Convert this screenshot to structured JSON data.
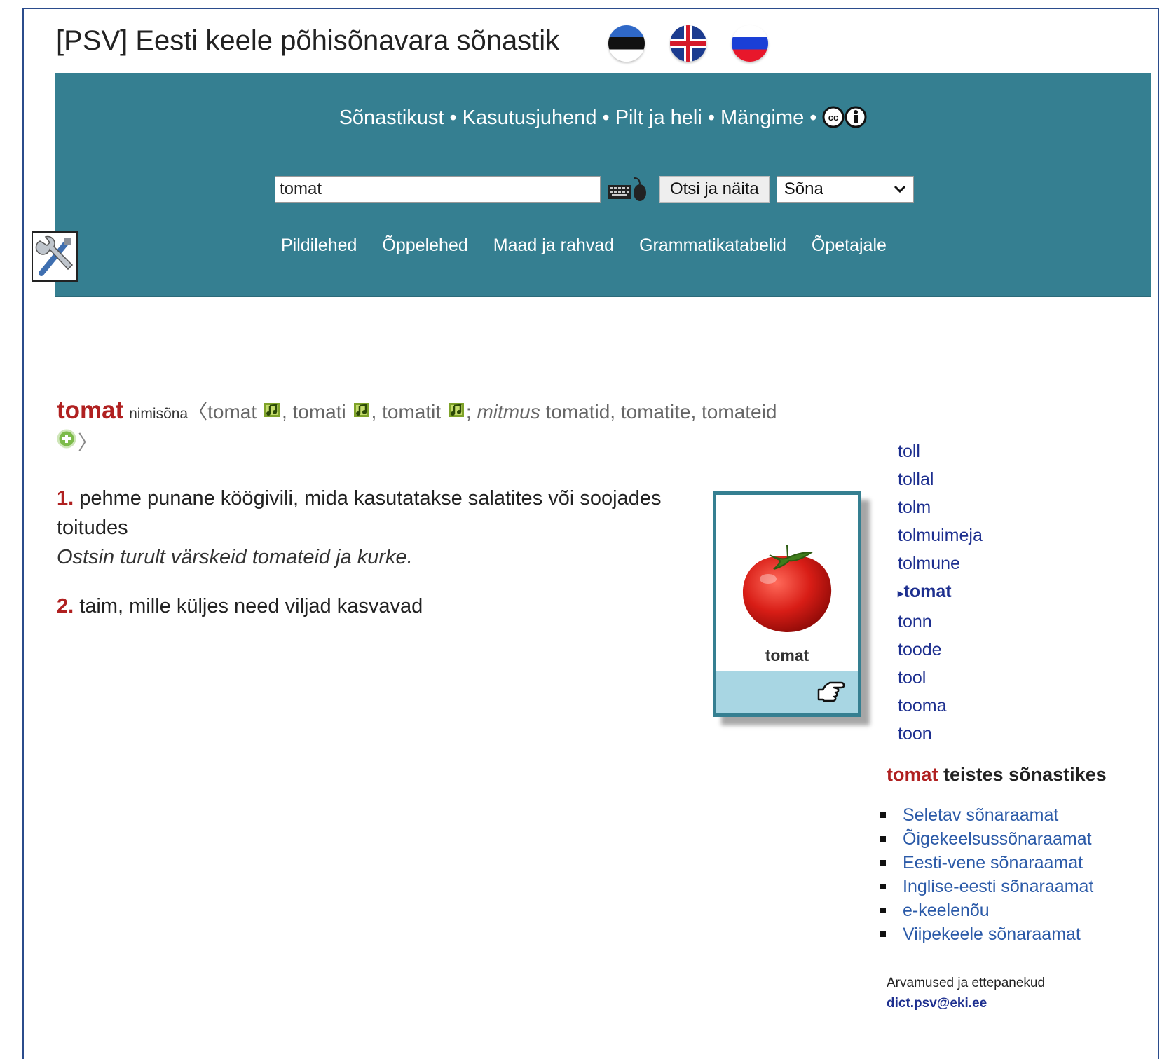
{
  "header": {
    "title": "[PSV] Eesti keele põhisõnavara sõnastik",
    "flags": [
      "ee-flag-icon",
      "gb-flag-icon",
      "ru-flag-icon"
    ]
  },
  "nav": {
    "links": [
      "Sõnastikust",
      "Kasutusjuhend",
      "Pilt ja heli",
      "Mängime"
    ],
    "separator": "•"
  },
  "search": {
    "value": "tomat",
    "button_label": "Otsi ja näita",
    "select_value": "Sõna"
  },
  "subnav": [
    "Pildilehed",
    "Õppelehed",
    "Maad ja rahvad",
    "Grammatikatabelid",
    "Õpetajale"
  ],
  "entry": {
    "headword": "tomat",
    "pos": "nimisõna",
    "open_bracket": "〈",
    "close_bracket": "〉",
    "forms": [
      "tomat",
      "tomati",
      "tomatit"
    ],
    "comma": ", ",
    "semicolon": "; ",
    "plural_label": "mitmus",
    "plural_forms": "tomatid, tomatite, tomateid",
    "senses": [
      {
        "num": "1.",
        "text": "pehme punane köögivili, mida kasutatakse salatites või soojades toitudes",
        "example": "Ostsin turult värskeid tomateid ja kurke."
      },
      {
        "num": "2.",
        "text": "taim, mille küljes need viljad kasvavad",
        "example": ""
      }
    ]
  },
  "picture_card": {
    "caption": "tomat"
  },
  "word_list": [
    "toll",
    "tollal",
    "tolm",
    "tolmuimeja",
    "tolmune",
    "tomat",
    "tonn",
    "toode",
    "tool",
    "tooma",
    "toon"
  ],
  "word_list_current": "tomat",
  "other_dicts": {
    "word": "tomat",
    "heading_rest": "teistes sõnastikes",
    "items": [
      "Seletav sõnaraamat",
      "Õigekeelsussõnaraamat",
      "Eesti-vene sõnaraamat",
      "Inglise-eesti sõnaraamat",
      "e-keelenõu",
      "Viipekeele sõnaraamat"
    ]
  },
  "feedback": {
    "label": "Arvamused ja ettepanekud",
    "email": "dict.psv@eki.ee"
  },
  "colors": {
    "banner": "#357f91",
    "headword": "#b02020",
    "link": "#1d2f8f",
    "card_bar": "#a8d6e3"
  }
}
